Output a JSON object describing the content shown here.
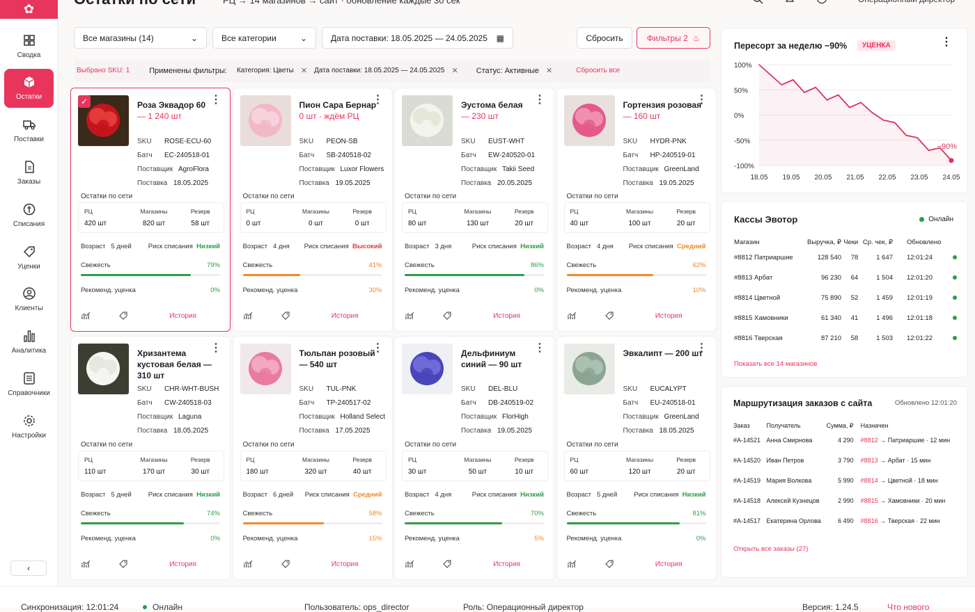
{
  "header": {
    "title": "Остатки по сети",
    "subtitle": "РЦ → 14 магазинов → сайт · обновление каждые 30 сек",
    "role": "Операционный директор"
  },
  "nav": [
    {
      "label": "Сводка",
      "icon": "dashboard-icon"
    },
    {
      "label": "Остатки",
      "icon": "box-icon",
      "active": true
    },
    {
      "label": "Поставки",
      "icon": "truck-icon"
    },
    {
      "label": "Заказы",
      "icon": "document-icon"
    },
    {
      "label": "Списания",
      "icon": "writeoff-icon"
    },
    {
      "label": "Уценки",
      "icon": "tag-icon"
    },
    {
      "label": "Клиенты",
      "icon": "users-icon"
    },
    {
      "label": "Аналитика",
      "icon": "chart-icon"
    },
    {
      "label": "Справочники",
      "icon": "book-icon"
    },
    {
      "label": "Настройки",
      "icon": "gear-icon"
    }
  ],
  "toolbar": {
    "stores": "Все магазины (14)",
    "categories": "Все категории",
    "date": "Дата поставки: 18.05.2025 — 24.05.2025",
    "reset": "Сбросить",
    "filters": "Фильтры",
    "filters_count": "2"
  },
  "filterbar": {
    "selected": "Выбрано SKU: 1",
    "applied": "Применены фильтры:",
    "chip1": "Категория: Цветы",
    "chip2": "Дата поставки: 18.05.2025 — 24.05.2025",
    "chip3": "Статус:  Активные",
    "reset_all": "Сбросить все"
  },
  "card_labels": {
    "sku": "SKU",
    "batch": "Батч",
    "supplier": "Поставщик",
    "delivery": "Поставка",
    "stock": "Остатки по сети",
    "dc": "РЦ",
    "stores": "Магазины",
    "reserve": "Резерв",
    "age": "Возраст",
    "risk": "Риск списания",
    "fresh": "Свежесть",
    "markdown": "Рекоменд. уценка",
    "history": "История"
  },
  "cards": [
    {
      "name": "Роза Эквадор 60",
      "qty": "— 1 240 шт",
      "sku": "ROSE-ECU-60",
      "batch": "EC-240518-01",
      "supplier": "AgroFlora",
      "delivery": "18.05.2025",
      "dc": "420 шт",
      "stores": "820 шт",
      "reserve": "58 шт",
      "age": "5 дней",
      "risk": "Низкий",
      "risk_level": "low",
      "fresh": "79%",
      "fresh_value": 79,
      "markdown": "0%",
      "selected": true
    },
    {
      "name": "Пион Сара Бернар",
      "qty": "0 шт · ждём РЦ",
      "sku": "PEON-SB",
      "batch": "SB-240518-02",
      "supplier": "Luxor Flowers",
      "delivery": "19.05.2025",
      "dc": "0 шт",
      "stores": "0 шт",
      "reserve": "0 шт",
      "age": "4 дня",
      "risk": "Высокий",
      "risk_level": "high",
      "fresh": "41%",
      "fresh_value": 41,
      "markdown": "30%"
    },
    {
      "name": "Эустома белая",
      "qty": "— 230 шт",
      "sku": "EUST-WHT",
      "batch": "EW-240520-01",
      "supplier": "Takii Seed",
      "delivery": "20.05.2025",
      "dc": "80 шт",
      "stores": "130 шт",
      "reserve": "20 шт",
      "age": "3 дня",
      "risk": "Низкий",
      "risk_level": "low",
      "fresh": "86%",
      "fresh_value": 86,
      "markdown": "0%"
    },
    {
      "name": "Гортензия розовая",
      "qty": "— 160 шт",
      "sku": "HYDR-PNK",
      "batch": "HP-240519-01",
      "supplier": "GreenLand",
      "delivery": "19.05.2025",
      "dc": "40 шт",
      "stores": "100 шт",
      "reserve": "20 шт",
      "age": "4 дня",
      "risk": "Средний",
      "risk_level": "mid",
      "fresh": "62%",
      "fresh_value": 62,
      "markdown": "10%"
    },
    {
      "name": "Хризантема кустовая белая — 310 шт",
      "qty": "",
      "sku": "CHR-WHT-BUSH",
      "batch": "CW-240518-03",
      "supplier": "Laguna",
      "delivery": "18.05.2025",
      "dc": "110 шт",
      "stores": "170 шт",
      "reserve": "30 шт",
      "age": "5 дней",
      "risk": "Низкий",
      "risk_level": "low",
      "fresh": "74%",
      "fresh_value": 74,
      "markdown": "0%"
    },
    {
      "name": "Тюльпан розовый — 540 шт",
      "qty": "",
      "sku": "TUL-PNK",
      "batch": "TP-240517-02",
      "supplier": "Holland Select",
      "delivery": "17.05.2025",
      "dc": "180 шт",
      "stores": "320 шт",
      "reserve": "40 шт",
      "age": "6 дней",
      "risk": "Средний",
      "risk_level": "mid",
      "fresh": "58%",
      "fresh_value": 58,
      "markdown": "15%"
    },
    {
      "name": "Дельфиниум синий — 90 шт",
      "qty": "",
      "sku": "DEL-BLU",
      "batch": "DB-240519-02",
      "supplier": "FlorHigh",
      "delivery": "19.05.2025",
      "dc": "30 шт",
      "stores": "50 шт",
      "reserve": "10 шт",
      "age": "4 дня",
      "risk": "Низкий",
      "risk_level": "low",
      "fresh": "70%",
      "fresh_value": 70,
      "markdown": "5%"
    },
    {
      "name": "Эвкалипт — 200 шт",
      "qty": "",
      "sku": "EUCALYPT",
      "batch": "EU-240518-01",
      "supplier": "GreenLand",
      "delivery": "18.05.2025",
      "dc": "60 шт",
      "stores": "120 шт",
      "reserve": "20 шт",
      "age": "5 дней",
      "risk": "Низкий",
      "risk_level": "low",
      "fresh": "81%",
      "fresh_value": 81,
      "markdown": "0%"
    }
  ],
  "chart_panel": {
    "title": "Пересорт за неделю −90%",
    "badge": "УЦЕНКА",
    "end_label": "−90%"
  },
  "chart_data": {
    "type": "line",
    "x": [
      "18.05",
      "19.05",
      "20.05",
      "21.05",
      "22.05",
      "23.05",
      "24.05"
    ],
    "values": [
      100,
      80,
      60,
      70,
      45,
      55,
      30,
      40,
      15,
      25,
      5,
      -10,
      -15,
      -40,
      -45,
      -70,
      -65,
      -90
    ],
    "yticks": [
      "100%",
      "50%",
      "0%",
      "-50%",
      "-100%"
    ],
    "ylim": [
      -100,
      100
    ],
    "color": "#d7365e"
  },
  "kassy": {
    "title": "Кассы Эвотор",
    "status": "Онлайн",
    "cols": [
      "Магазин",
      "Выручка, ₽",
      "Чеки",
      "Ср. чек, ₽",
      "Обновлено"
    ],
    "rows": [
      [
        "#8812 Патриаршие",
        "128 540",
        "78",
        "1 647",
        "12:01:24"
      ],
      [
        "#8813 Арбат",
        "96 230",
        "64",
        "1 504",
        "12:01:20"
      ],
      [
        "#8814 Цветной",
        "75 890",
        "52",
        "1 459",
        "12:01:19"
      ],
      [
        "#8815 Хамовники",
        "61 340",
        "41",
        "1 496",
        "12:01:18"
      ],
      [
        "#8816 Тверская",
        "87 210",
        "58",
        "1 503",
        "12:01:22"
      ]
    ],
    "link": "Показать все 14 магазинов"
  },
  "routing": {
    "title": "Маршрутизация заказов с сайта",
    "updated": "Обновлено 12:01:20",
    "cols": [
      "Заказ",
      "Получатель",
      "Сумма, ₽",
      "Назначен"
    ],
    "rows": [
      [
        "#А-14521",
        "Анна Смирнова",
        "4 290",
        "#8812",
        "→ Патриаршие · 12 мин"
      ],
      [
        "#А-14520",
        "Иван Петров",
        "3 790",
        "#8813",
        "→ Арбат · 15 мин"
      ],
      [
        "#А-14519",
        "Мария Волкова",
        "5 990",
        "#8814",
        "→ Цветной · 18 мин"
      ],
      [
        "#А-14518",
        "Алексей Кузнецов",
        "2 990",
        "#8815",
        "→ Хамовники · 20 мин"
      ],
      [
        "#А-14517",
        "Екатерина Орлова",
        "6 490",
        "#8816",
        "→ Тверская · 22 мин"
      ]
    ],
    "link": "Открыть все заказы (27)"
  },
  "footer": {
    "sync": "Синхронизация:  12:01:24",
    "online": "Онлайн",
    "user": "Пользователь:  ops_director",
    "role": "Роль:  Операционный директор",
    "version": "Версия:  1.24.5",
    "whatsnew": "Что нового"
  }
}
